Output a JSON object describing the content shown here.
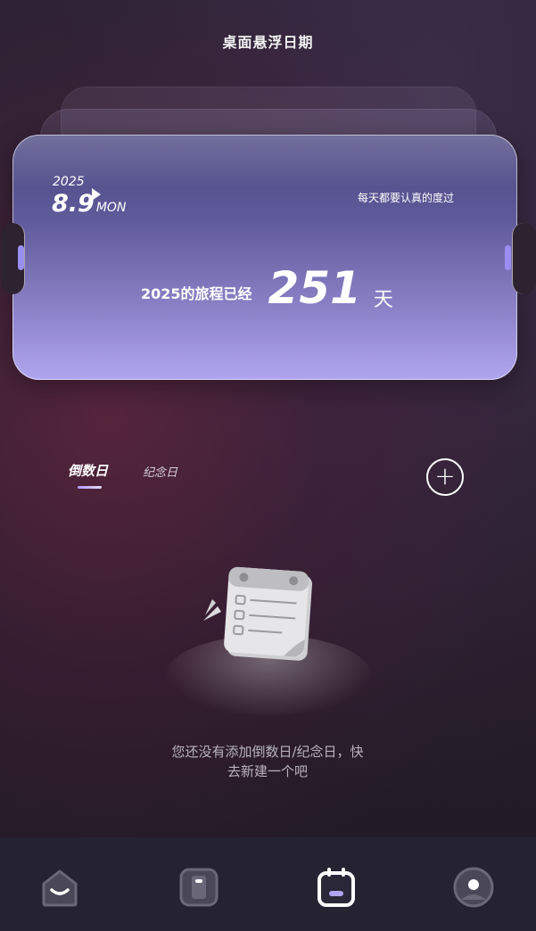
{
  "header": {
    "title": "桌面悬浮日期"
  },
  "card": {
    "year": "2025",
    "date": "8.9",
    "weekday": "MON",
    "motto": "每天都要认真的度过",
    "journey_label": "2025的旅程已经",
    "journey_days": "251",
    "journey_unit": "天"
  },
  "tabs": [
    {
      "label": "倒数日",
      "active": true
    },
    {
      "label": "纪念日",
      "active": false
    }
  ],
  "empty_state": {
    "line1": "您还没有添加倒数日/纪念日，快",
    "line2": "去新建一个吧"
  },
  "bottom_nav": {
    "items": [
      {
        "icon": "home-icon"
      },
      {
        "icon": "widget-icon"
      },
      {
        "icon": "calendar-icon",
        "active": true
      },
      {
        "icon": "profile-icon"
      }
    ]
  },
  "colors": {
    "accent": "#b0a5ef",
    "card_top": "#4b4880",
    "card_bottom": "#b0a5ef",
    "nav_bg": "#252232"
  }
}
